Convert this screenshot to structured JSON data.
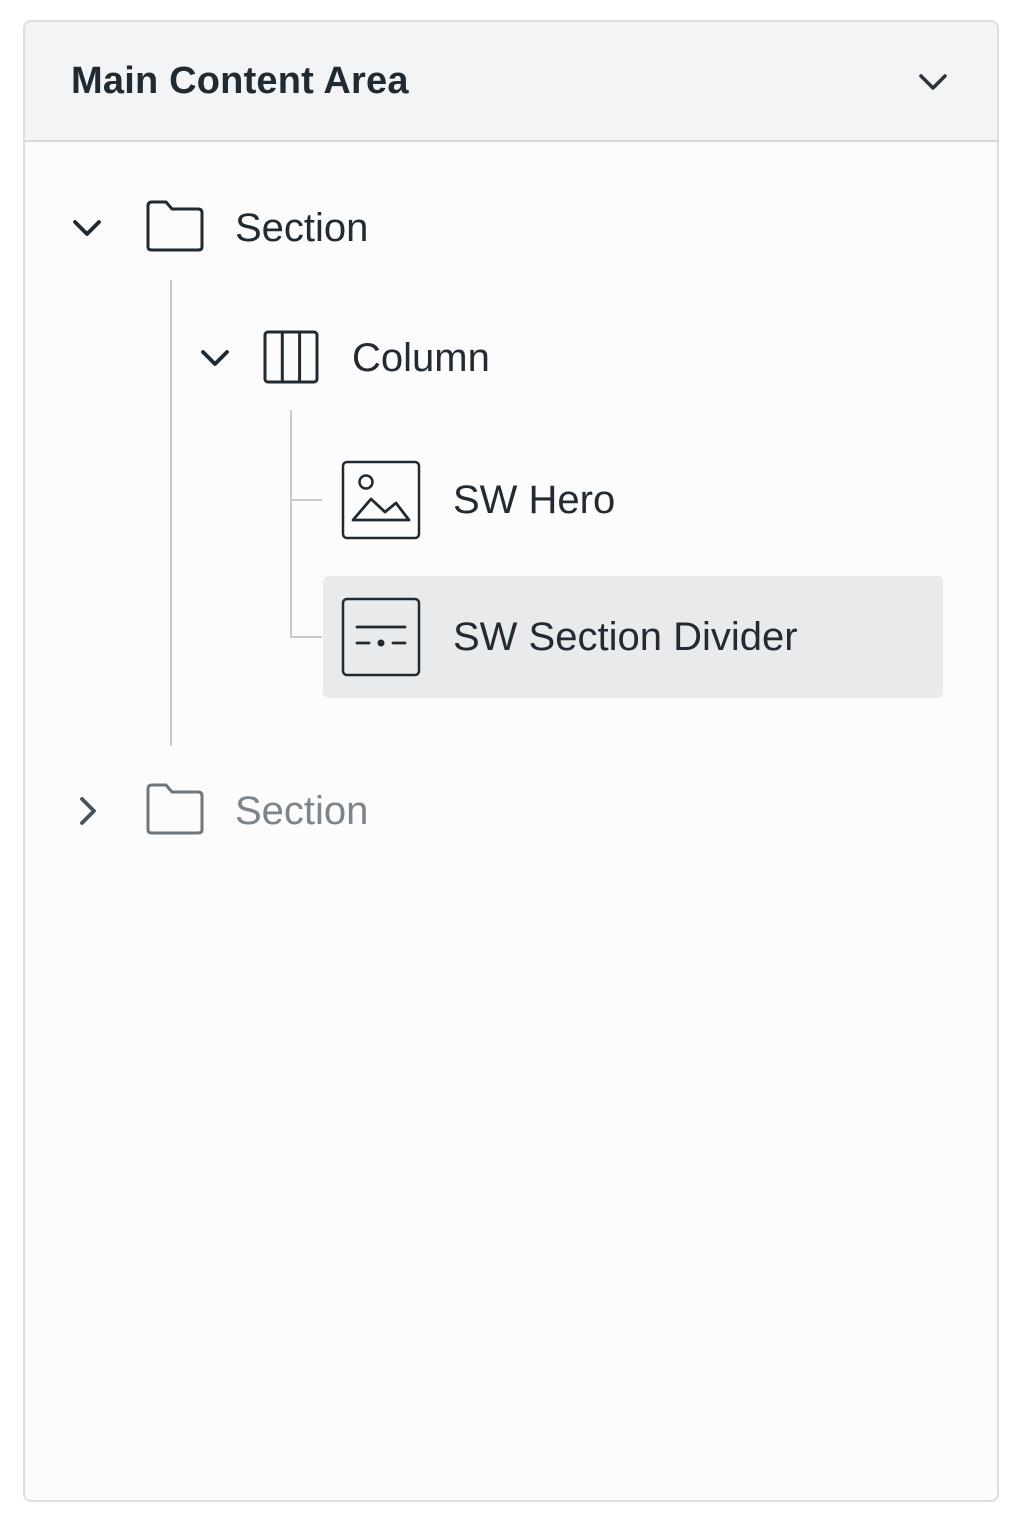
{
  "panel": {
    "title": "Main Content Area",
    "header_icon": "chevron-down-icon"
  },
  "tree": {
    "section_1": {
      "label": "Section",
      "expanded": true,
      "icon": "folder-icon"
    },
    "column": {
      "label": "Column",
      "expanded": true,
      "icon": "columns-icon"
    },
    "hero": {
      "label": "SW Hero",
      "icon": "image-icon"
    },
    "divider": {
      "label": "SW Section Divider",
      "icon": "divider-icon",
      "selected": true
    },
    "section_2": {
      "label": "Section",
      "expanded": false,
      "icon": "folder-icon"
    }
  },
  "colors": {
    "text": "#222b33",
    "muted_text": "#7c848c",
    "selected_bg": "#e9eaec",
    "header_bg": "#f3f4f6",
    "guide": "#c6cacf"
  }
}
